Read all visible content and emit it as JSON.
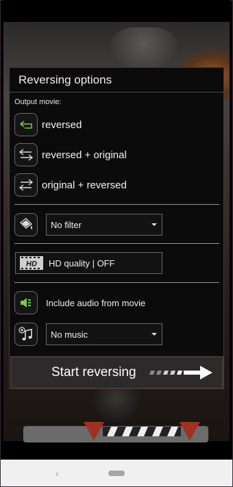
{
  "dialog": {
    "title": "Reversing options",
    "output_label": "Output movie:",
    "output_options": [
      {
        "label": "reversed",
        "icon": "reverse-arrow-icon",
        "selected": true
      },
      {
        "label": "reversed + original",
        "icon": "reverse-original-icon",
        "selected": false
      },
      {
        "label": "original + reversed",
        "icon": "original-reverse-icon",
        "selected": false
      }
    ],
    "filter": {
      "icon": "paint-bucket-icon",
      "value": "No filter"
    },
    "hd": {
      "icon": "hd-film-icon",
      "icon_text": "HD",
      "label": "HD quality | OFF"
    },
    "audio": {
      "icon": "speaker-icon",
      "label": "Include audio from movie"
    },
    "music": {
      "icon": "music-add-icon",
      "value": "No music"
    },
    "start_button": "Start reversing"
  },
  "navbar": {
    "back_glyph": "‹"
  },
  "colors": {
    "accent_green": "#7ac943",
    "dialog_bg": "#0b0b0b",
    "button_bg": "#2c2a2a"
  }
}
